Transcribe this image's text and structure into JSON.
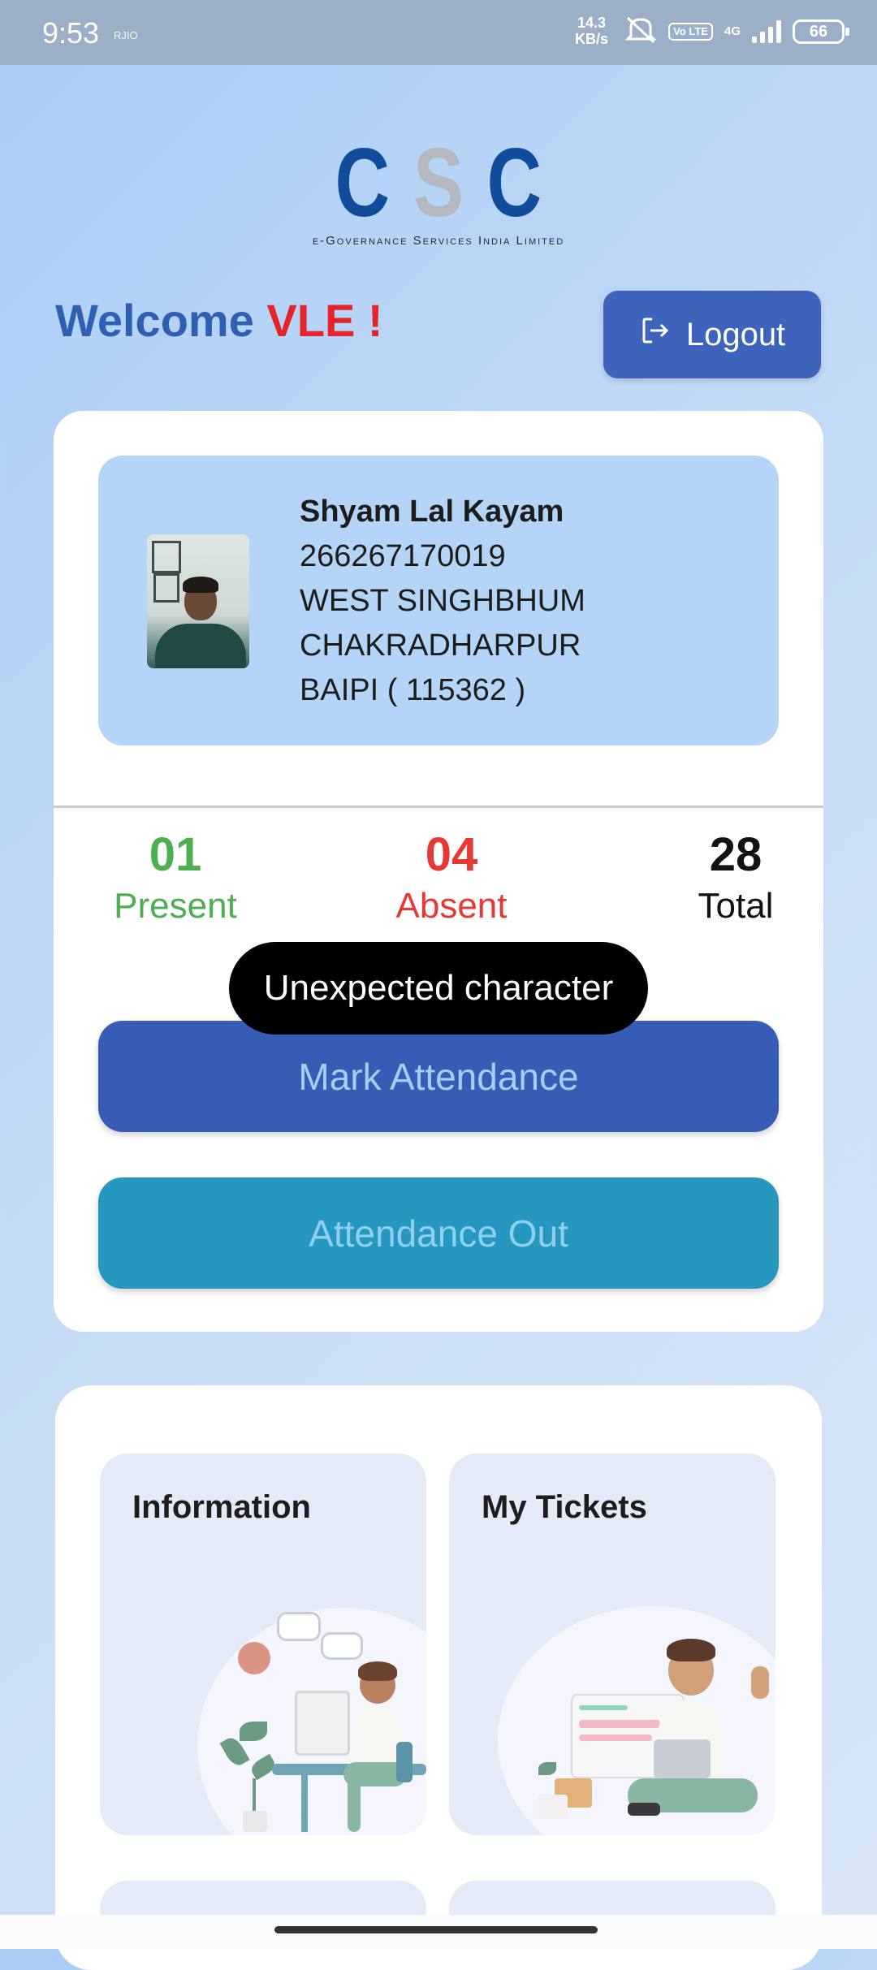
{
  "status_bar": {
    "time": "9:53",
    "carrier_icon_text": "RJIO",
    "speed_value": "14.3",
    "speed_unit": "KB/s",
    "volte": "Vo LTE",
    "network": "4G",
    "battery": "66",
    "icons": [
      "mute-icon",
      "volte-icon",
      "signal-icon",
      "battery-icon"
    ]
  },
  "logo": {
    "letters": [
      "C",
      "S",
      "C"
    ],
    "subtitle": "e-Governance Services India Limited"
  },
  "header": {
    "welcome_prefix": "Welcome",
    "welcome_name": "VLE !",
    "logout_label": "Logout",
    "logout_icon": "logout-icon"
  },
  "profile": {
    "name": "Shyam Lal Kayam",
    "id": "266267170019",
    "district": "WEST SINGHBHUM",
    "block": "CHAKRADHARPUR",
    "panchayat": "BAIPI ( 115362 )"
  },
  "stats": {
    "present_value": "01",
    "present_label": "Present",
    "absent_value": "04",
    "absent_label": "Absent",
    "total_value": "28",
    "total_label": "Total"
  },
  "actions": {
    "mark_attendance": "Mark Attendance",
    "attendance_out": "Attendance Out"
  },
  "toast": {
    "message": "Unexpected character"
  },
  "tiles": [
    {
      "title": "Information"
    },
    {
      "title": "My Tickets"
    }
  ],
  "colors": {
    "primary": "#375cb6",
    "secondary": "#2697be",
    "present": "#4caf50",
    "absent": "#e53935",
    "brand_blue": "#0f4c9b",
    "brand_red": "#e3242b"
  }
}
